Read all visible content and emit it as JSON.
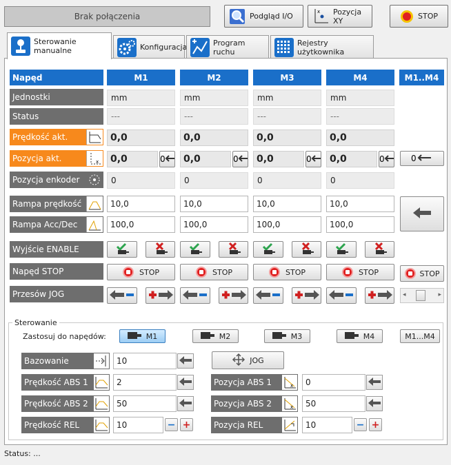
{
  "toolbar": {
    "connection_status": "Brak połączenia",
    "io_label": "Podgląd I/O",
    "xy_label": "Pozycja XY",
    "stop_label": "STOP"
  },
  "tabs": [
    {
      "label": "Sterowanie manualne",
      "icon": "joystick-icon",
      "active": true
    },
    {
      "label": "Konfiguracja",
      "icon": "gears-icon",
      "active": false
    },
    {
      "label": "Program ruchu",
      "icon": "graph-icon",
      "active": false
    },
    {
      "label": "Rejestry użytkownika",
      "icon": "grid-icon",
      "active": false
    }
  ],
  "table": {
    "header_label": "Napęd",
    "columns": [
      "M1",
      "M2",
      "M3",
      "M4",
      "M1..M4"
    ],
    "rows": {
      "units": {
        "label": "Jednostki",
        "values": [
          "mm",
          "mm",
          "mm",
          "mm"
        ]
      },
      "status": {
        "label": "Status",
        "values": [
          "---",
          "---",
          "---",
          "---"
        ]
      },
      "speed": {
        "label": "Prędkość akt.",
        "values": [
          "0,0",
          "0,0",
          "0,0",
          "0,0"
        ]
      },
      "position": {
        "label": "Pozycja akt.",
        "values": [
          "0,0",
          "0,0",
          "0,0",
          "0,0"
        ]
      },
      "encoder": {
        "label": "Pozycja enkoder",
        "values": [
          "0",
          "0",
          "0",
          "0"
        ]
      },
      "ramp_speed": {
        "label": "Rampa prędkość",
        "values": [
          "10,0",
          "10,0",
          "10,0",
          "10,0"
        ]
      },
      "ramp_acc": {
        "label": "Rampa Acc/Dec",
        "values": [
          "100,0",
          "100,0",
          "100,0",
          "100,0"
        ]
      },
      "enable": {
        "label": "Wyjście ENABLE"
      },
      "stop": {
        "label": "Napęd STOP",
        "button_label": "STOP"
      },
      "jog": {
        "label": "Przesów JOG"
      }
    }
  },
  "control": {
    "group_label": "Sterowanie",
    "apply_label": "Zastosuj do napędów:",
    "drives": [
      "M1",
      "M2",
      "M3",
      "M4",
      "M1...M4"
    ],
    "homing": {
      "label": "Bazowanie",
      "value": "10"
    },
    "jog_label": "JOG",
    "abs_speed1": {
      "label": "Prędkość ABS 1",
      "value": "2"
    },
    "abs_speed2": {
      "label": "Prędkość ABS 2",
      "value": "50"
    },
    "rel_speed": {
      "label": "Prędkość REL",
      "value": "10"
    },
    "abs_pos1": {
      "label": "Pozycja ABS 1",
      "value": "0"
    },
    "abs_pos2": {
      "label": "Pozycja ABS 2",
      "value": "50"
    },
    "rel_pos": {
      "label": "Pozycja REL",
      "value": "10"
    }
  },
  "statusbar": {
    "text": "Status: ..."
  },
  "colors": {
    "header_blue": "#1a6fc9",
    "orange": "#f7891c",
    "label_gray": "#6e6e6e",
    "stop_red": "#e02020"
  }
}
